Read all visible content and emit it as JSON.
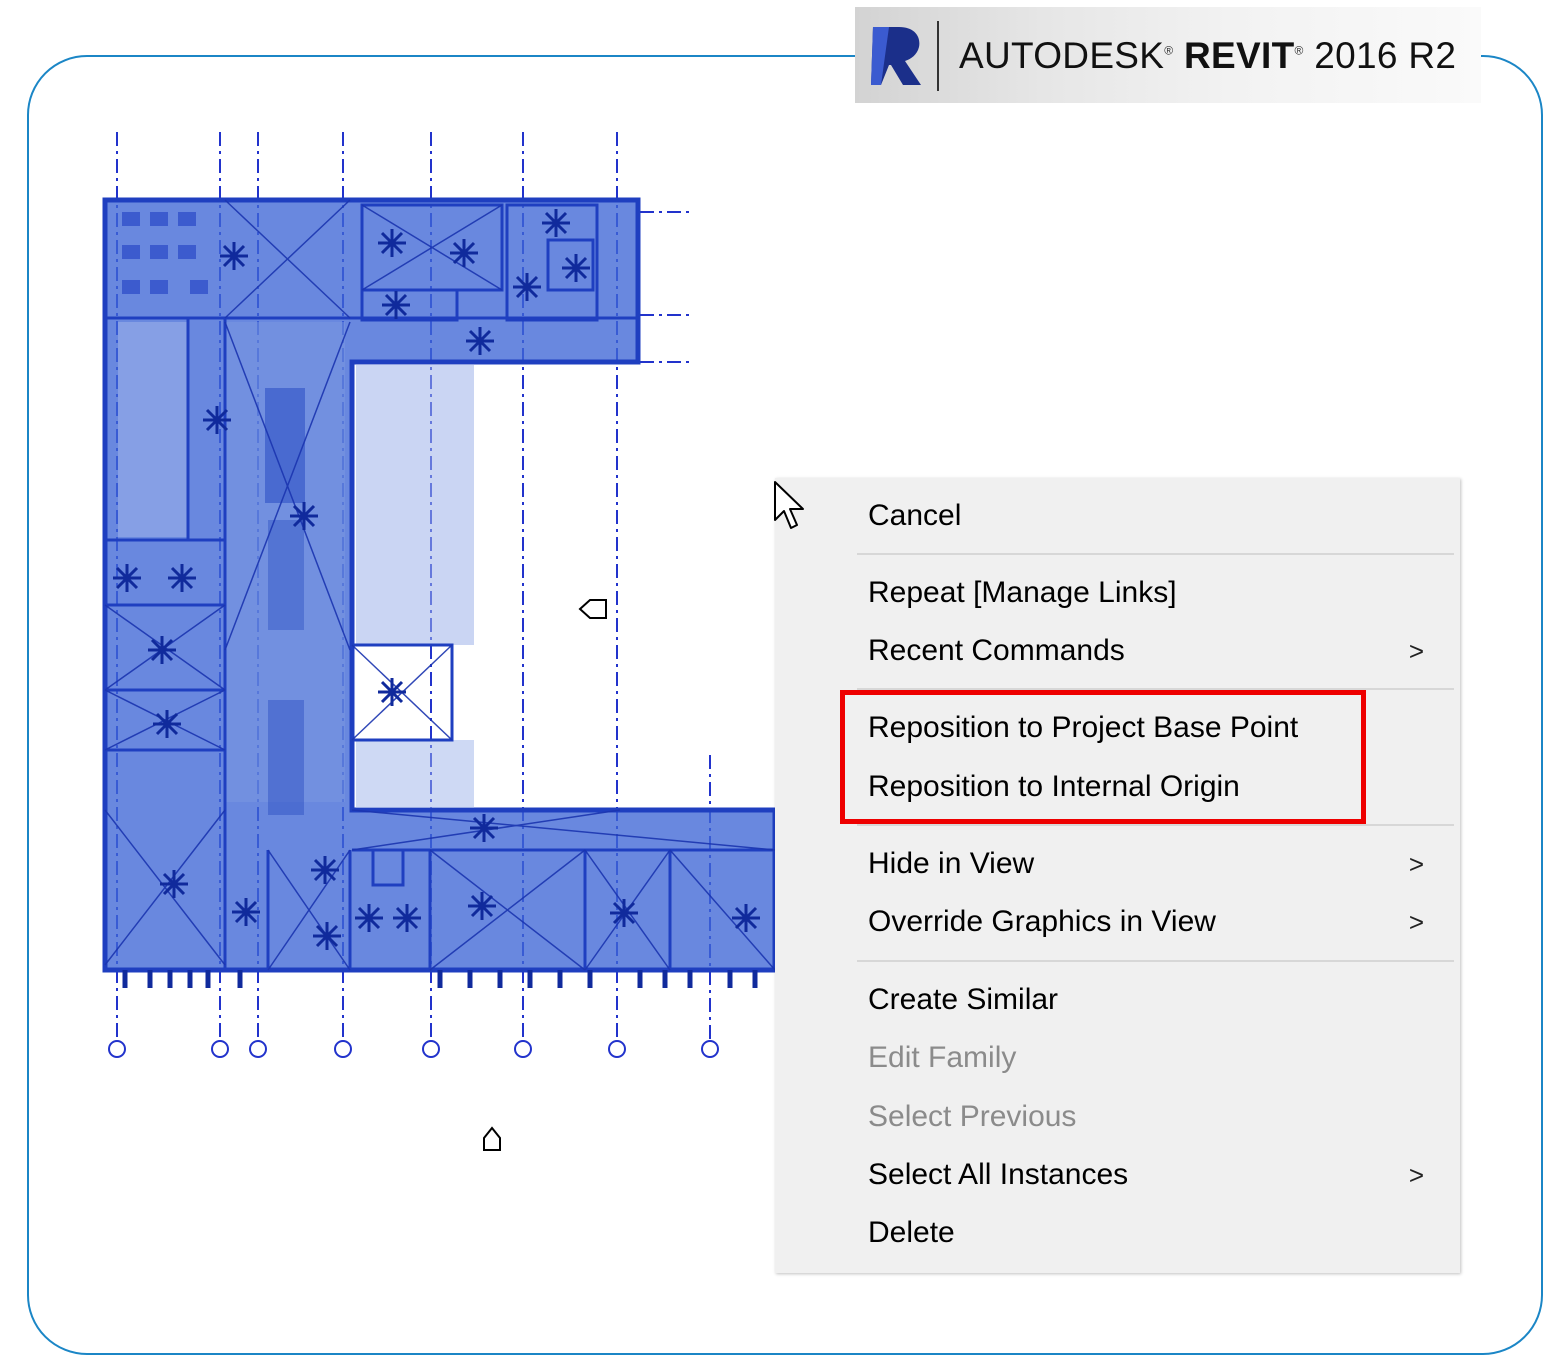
{
  "banner": {
    "brand_prefix": "AUTODESK",
    "brand_product": "REVIT",
    "brand_version": "2016 R2",
    "logo_icon": "revit-r-logo-icon"
  },
  "context_menu": {
    "items": [
      {
        "label": "Cancel",
        "enabled": true,
        "submenu": false
      },
      {
        "label": "Repeat [Manage Links]",
        "enabled": true,
        "submenu": false
      },
      {
        "label": "Recent Commands",
        "enabled": true,
        "submenu": true
      },
      {
        "label": "Reposition to Project Base Point",
        "enabled": true,
        "submenu": false
      },
      {
        "label": "Reposition to Internal Origin",
        "enabled": true,
        "submenu": false
      },
      {
        "label": "Hide in View",
        "enabled": true,
        "submenu": true
      },
      {
        "label": "Override Graphics in View",
        "enabled": true,
        "submenu": true
      },
      {
        "label": "Create Similar",
        "enabled": true,
        "submenu": false
      },
      {
        "label": "Edit Family",
        "enabled": false,
        "submenu": false
      },
      {
        "label": "Select Previous",
        "enabled": false,
        "submenu": false
      },
      {
        "label": "Select All Instances",
        "enabled": true,
        "submenu": true
      },
      {
        "label": "Delete",
        "enabled": true,
        "submenu": false
      }
    ],
    "submenu_arrow": ">"
  },
  "colors": {
    "selection_blue": "#3f66d6",
    "grid_blue": "#2233cc",
    "frame_blue": "#1b86c6",
    "highlight_red": "#ee0000",
    "menu_bg": "#f0f0f0"
  }
}
